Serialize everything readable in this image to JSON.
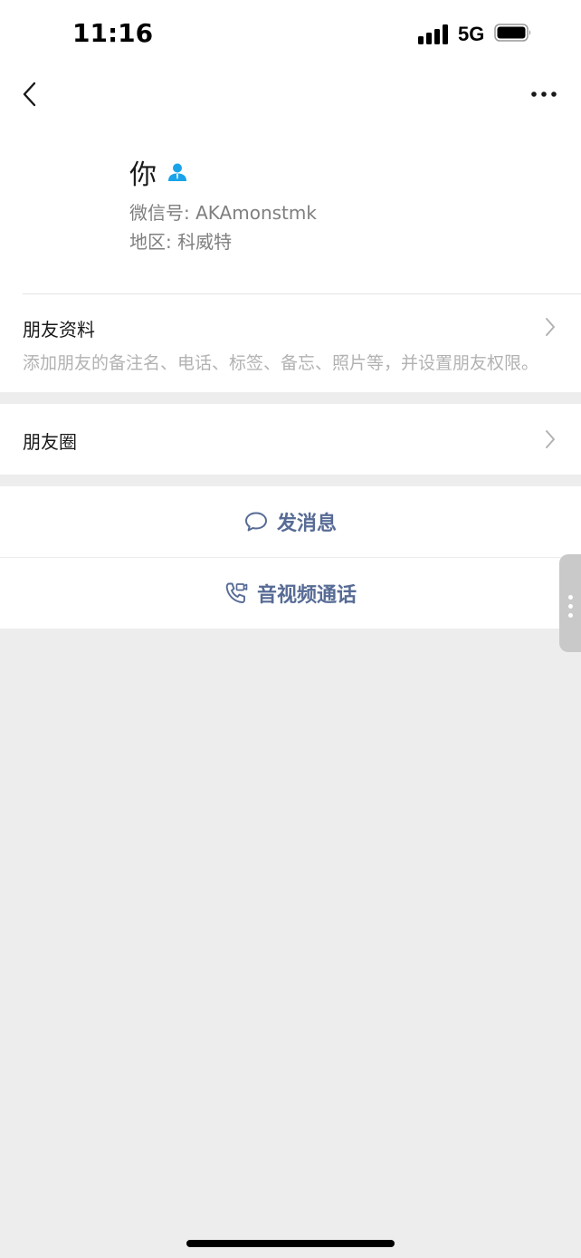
{
  "status_bar": {
    "time": "11:16",
    "network": "5G"
  },
  "nav": {
    "back_icon": "chevron-left-icon",
    "more_icon": "more-dots-icon"
  },
  "profile": {
    "name": "你",
    "friend_icon": "person-icon",
    "wechat_id_line": "微信号: AKAmonstmk",
    "region_line": "地区: 科威特"
  },
  "friend_info": {
    "title": "朋友资料",
    "description": "添加朋友的备注名、电话、标签、备忘、照片等，并设置朋友权限。"
  },
  "moments": {
    "title": "朋友圈"
  },
  "actions": {
    "message_label": "发消息",
    "call_label": "音视频通话"
  },
  "colors": {
    "action_text": "#576b95",
    "friend_icon": "#1aa3e8",
    "background": "#ededed"
  }
}
